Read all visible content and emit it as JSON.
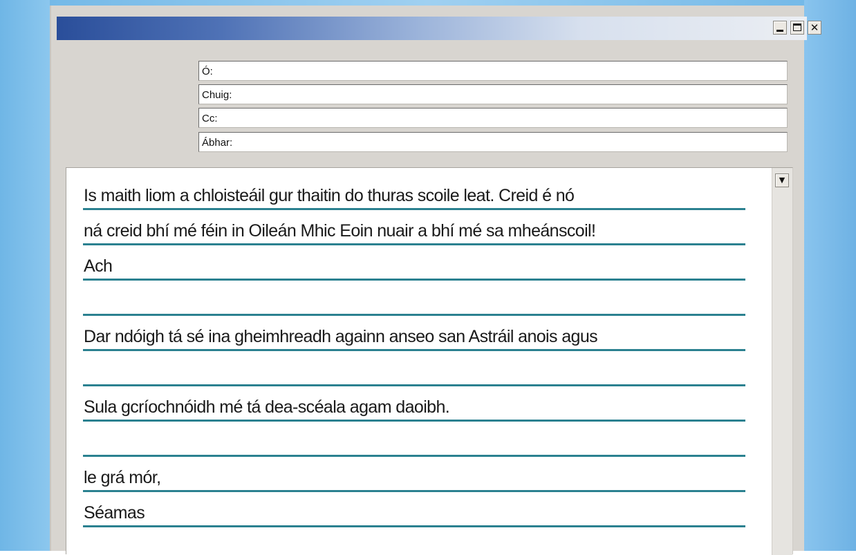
{
  "window": {
    "controls": {
      "minimize_icon": "minimize-icon",
      "maximize_icon": "maximize-icon",
      "close_icon": "close-icon",
      "close_glyph": "✕"
    }
  },
  "header_fields": {
    "from_label": "Ó:",
    "to_label": "Chuig:",
    "cc_label": "Cc:",
    "subject_label": "Ábhar:"
  },
  "body": {
    "lines": [
      "Is maith liom a chloisteáil gur thaitin do thuras scoile leat. Creid é nó",
      "ná creid bhí mé féin in Oileán Mhic Eoin nuair a bhí mé sa mheánscoil!",
      "Ach",
      "",
      "Dar ndóigh tá sé ina gheimhreadh againn anseo san Astráil anois agus",
      "",
      "Sula gcríochnóidh mé tá dea-scéala agam daoibh.",
      "",
      "le grá mór,",
      "Séamas"
    ],
    "scroll_arrow_glyph": "▼"
  },
  "colors": {
    "rule_line": "#2b8190",
    "titlebar_start": "#2a4e9a",
    "titlebar_end": "#ebeef3",
    "desktop": "#7dbde9"
  }
}
